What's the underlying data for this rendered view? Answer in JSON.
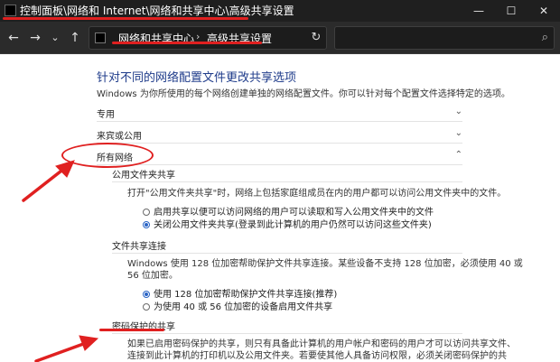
{
  "window": {
    "title": "控制面板\\网络和 Internet\\网络和共享中心\\高级共享设置",
    "minimize": "—",
    "maximize": "☐",
    "close": "✕"
  },
  "nav": {
    "back": "←",
    "forward": "→",
    "dropdown": "⌄",
    "up": "↑",
    "breadcrumbs": [
      "网络和共享中心",
      "高级共享设置"
    ],
    "breadcrumb_sep": "›",
    "refresh": "↻",
    "search_icon": "⌕"
  },
  "content": {
    "heading": "针对不同的网络配置文件更改共享选项",
    "description": "Windows 为你所使用的每个网络创建单独的网络配置文件。你可以针对每个配置文件选择特定的选项。",
    "sections": {
      "private": {
        "label": "专用",
        "chev": "⌄"
      },
      "guest": {
        "label": "来宾或公用",
        "chev": "⌄"
      },
      "all": {
        "label": "所有网络",
        "chev": "⌃"
      }
    },
    "public_folder": {
      "title": "公用文件夹共享",
      "text": "打开\"公用文件夹共享\"时，网络上包括家庭组成员在内的用户都可以访问公用文件夹中的文件。",
      "options": [
        {
          "label": "启用共享以便可以访问网络的用户可以读取和写入公用文件夹中的文件",
          "selected": false
        },
        {
          "label": "关闭公用文件夹共享(登录到此计算机的用户仍然可以访问这些文件夹)",
          "selected": true
        }
      ]
    },
    "file_sharing": {
      "title": "文件共享连接",
      "text_line1": "Windows 使用 128 位加密帮助保护文件共享连接。某些设备不支持 128 位加密，必须使用 40 或",
      "text_line2": "56 位加密。",
      "options": [
        {
          "label": "使用 128 位加密帮助保护文件共享连接(推荐)",
          "selected": true
        },
        {
          "label": "为使用 40 或 56 位加密的设备启用文件共享",
          "selected": false
        }
      ]
    },
    "password": {
      "title": "密码保护的共享",
      "text_line1": "如果已启用密码保护的共享，则只有具备此计算机的用户帐户和密码的用户才可以访问共享文件、",
      "text_line2": "连接到此计算机的打印机以及公用文件夹。若要使其他人具备访问权限，必须关闭密码保护的共"
    }
  },
  "annotations": {
    "color": "#e02020"
  }
}
